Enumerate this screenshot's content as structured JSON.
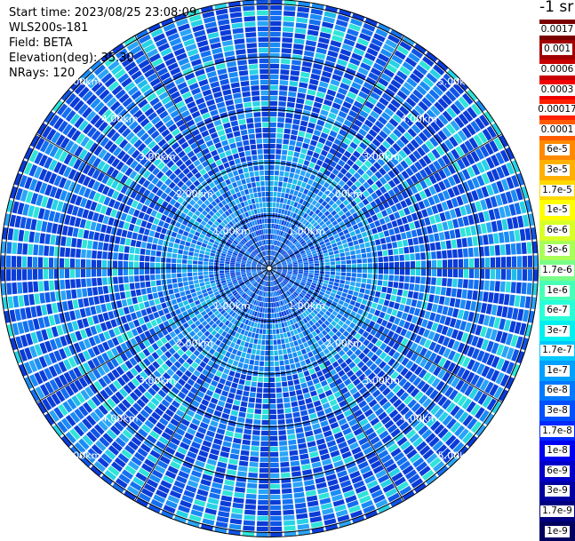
{
  "header": {
    "start_time": "Start time: 2023/08/25 23:08:09",
    "instrument": "WLS200s-181",
    "field": "Field: BETA",
    "elevation": "Elevation(deg): 35.30",
    "nrays": "NRays: 120"
  },
  "colorbar": {
    "unit_title": "-1 sr",
    "labels": [
      "0.0017",
      "0.001",
      "0.0006",
      "0.0003",
      "0.00017",
      "0.0001",
      "6e-5",
      "3e-5",
      "1.7e-5",
      "1e-5",
      "6e-6",
      "3e-6",
      "1.7e-6",
      "1e-6",
      "6e-7",
      "3e-7",
      "1.7e-7",
      "1e-7",
      "6e-8",
      "3e-8",
      "1.7e-8",
      "1e-8",
      "6e-9",
      "3e-9",
      "1.7e-9",
      "1e-9"
    ],
    "colors": [
      "#7a0000",
      "#a00000",
      "#c80000",
      "#f00000",
      "#ff2000",
      "#ff5a00",
      "#ff8a00",
      "#ffb000",
      "#ffd800",
      "#ffff00",
      "#d8ff28",
      "#a8ff58",
      "#78ff88",
      "#48ffb8",
      "#28ffd8",
      "#00f0f0",
      "#00c8ff",
      "#00a0ff",
      "#0078ff",
      "#0050ff",
      "#0028ff",
      "#0000f0",
      "#0000c8",
      "#0000a0",
      "#000080",
      "#000060"
    ]
  },
  "chart_data": {
    "type": "heatmap",
    "title": "",
    "field": "BETA",
    "n_rays": 120,
    "elevation_deg": 35.3,
    "range_rings_km": [
      1,
      2,
      3,
      4,
      5
    ],
    "ring_labels": [
      "1.00km",
      "2.00km",
      "3.00km",
      "4.00km",
      "5.00km"
    ],
    "value_range": [
      1e-09,
      0.0017
    ],
    "dominant_values": "mostly between 1e-8 and 1.7e-7 (blue to cyan)",
    "grid": true
  }
}
